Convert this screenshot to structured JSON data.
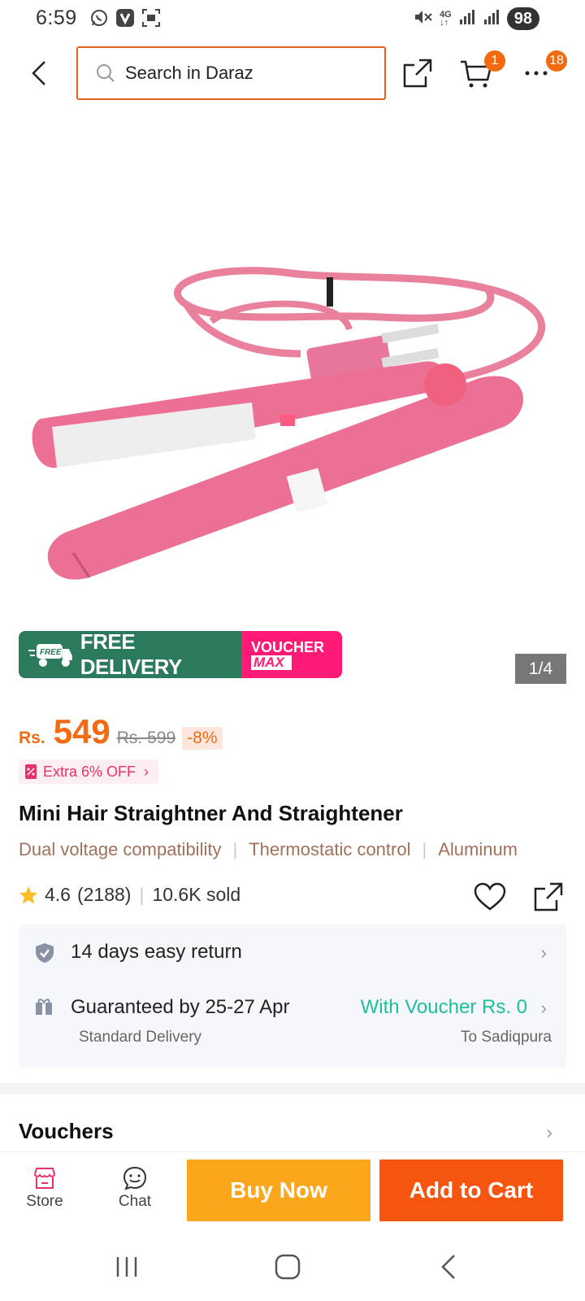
{
  "status_bar": {
    "time": "6:59",
    "battery": "98",
    "left_icons": [
      "whatsapp-icon",
      "v-app-icon",
      "screenshot-icon"
    ],
    "right_icons": [
      "mute-icon",
      "4g-icon",
      "signal-icon",
      "signal-icon"
    ]
  },
  "header": {
    "search_placeholder": "Search in Daraz",
    "cart_badge": "1",
    "more_badge": "18"
  },
  "gallery": {
    "page_indicator": "1/4"
  },
  "promo": {
    "free_tag": "FREE",
    "free_delivery": "FREE DELIVERY",
    "voucher_line1": "VOUCHER",
    "voucher_line2": "MAX"
  },
  "price": {
    "currency": "Rs.",
    "current": "549",
    "original": "Rs. 599",
    "discount": "-8%",
    "extra_off": "Extra 6% OFF"
  },
  "product": {
    "title": "Mini Hair Straightner And Straightener",
    "features": [
      "Dual voltage compatibility",
      "Thermostatic control",
      "Aluminum"
    ],
    "rating": "4.6",
    "reviews": "(2188)",
    "sold": "10.6K sold"
  },
  "info": {
    "return_text": "14 days easy return",
    "delivery_text": "Guaranteed by 25-27 Apr",
    "voucher_text": "With Voucher Rs. 0",
    "delivery_type": "Standard Delivery",
    "destination": "To Sadiqpura"
  },
  "vouchers": {
    "title": "Vouchers"
  },
  "bottom_bar": {
    "store_label": "Store",
    "chat_label": "Chat",
    "buy_now": "Buy Now",
    "add_to_cart": "Add to Cart"
  },
  "colors": {
    "accent": "#f36a10",
    "search_border": "#e8601c",
    "buy_now": "#fba61b",
    "add_to_cart": "#f5550f",
    "voucher_green": "#1cbfa0",
    "feature_text": "#a0715a",
    "product_pink": "#ec6f94"
  }
}
